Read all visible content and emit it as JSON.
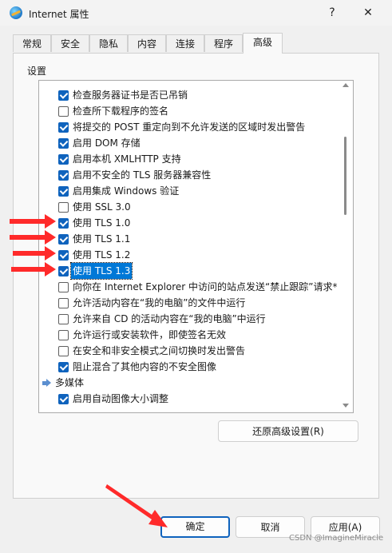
{
  "window": {
    "title": "Internet 属性",
    "help_glyph": "?",
    "close_glyph": "✕",
    "icon": "internet-explorer-icon"
  },
  "tabs": [
    {
      "label": "常规"
    },
    {
      "label": "安全"
    },
    {
      "label": "隐私"
    },
    {
      "label": "内容"
    },
    {
      "label": "连接"
    },
    {
      "label": "程序"
    },
    {
      "label": "高级",
      "active": true
    }
  ],
  "settings": {
    "group_label": "设置",
    "items": [
      {
        "label": "检查服务器证书是否已吊销",
        "checked": true
      },
      {
        "label": "检查所下载程序的签名",
        "checked": false
      },
      {
        "label": "将提交的 POST 重定向到不允许发送的区域时发出警告",
        "checked": true
      },
      {
        "label": "启用 DOM 存储",
        "checked": true
      },
      {
        "label": "启用本机 XMLHTTP 支持",
        "checked": true
      },
      {
        "label": "启用不安全的 TLS 服务器兼容性",
        "checked": true
      },
      {
        "label": "启用集成 Windows 验证",
        "checked": true
      },
      {
        "label": "使用 SSL 3.0",
        "checked": false
      },
      {
        "label": "使用 TLS 1.0",
        "checked": true
      },
      {
        "label": "使用 TLS 1.1",
        "checked": true
      },
      {
        "label": "使用 TLS 1.2",
        "checked": true
      },
      {
        "label": "使用 TLS 1.3",
        "checked": true,
        "selected": true
      },
      {
        "label": "向你在 Internet Explorer 中访问的站点发送“禁止跟踪”请求*",
        "checked": false
      },
      {
        "label": "允许活动内容在“我的电脑”的文件中运行",
        "checked": false
      },
      {
        "label": "允许来自 CD 的活动内容在“我的电脑”中运行",
        "checked": false
      },
      {
        "label": "允许运行或安装软件，即使签名无效",
        "checked": false
      },
      {
        "label": "在安全和非安全模式之间切换时发出警告",
        "checked": false
      },
      {
        "label": "阻止混合了其他内容的不安全图像",
        "checked": true
      }
    ],
    "category": {
      "label": "多媒体",
      "icon": "multimedia-category-icon"
    },
    "partial_item": {
      "label": "启用自动图像大小调整",
      "checked": true
    }
  },
  "buttons": {
    "restore_advanced": "还原高级设置(R)",
    "ok": "确定",
    "cancel": "取消",
    "apply": "应用(A)"
  },
  "watermark": "CSDN @ImagineMiracle",
  "colors": {
    "accent": "#0f63bd",
    "selection": "#0078d7",
    "annotation_arrow": "#ff2a2a"
  }
}
